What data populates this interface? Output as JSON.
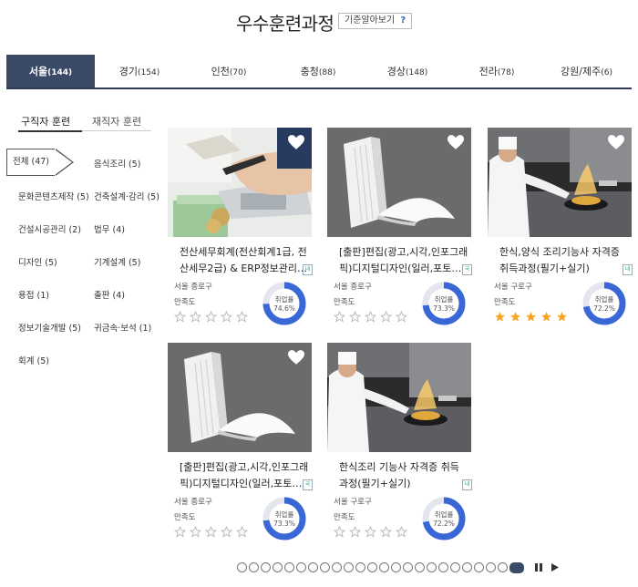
{
  "header": {
    "title": "우수훈련과정",
    "criteria_label": "기준알아보기",
    "criteria_icon": "?"
  },
  "regions": [
    {
      "label": "서울",
      "count": "(144)",
      "active": true
    },
    {
      "label": "경기",
      "count": "(154)"
    },
    {
      "label": "인천",
      "count": "(70)"
    },
    {
      "label": "충청",
      "count": "(88)"
    },
    {
      "label": "경상",
      "count": "(148)"
    },
    {
      "label": "전라",
      "count": "(78)"
    },
    {
      "label": "강원/제주",
      "count": "(6)"
    }
  ],
  "subtabs": [
    {
      "label": "구직자 훈련",
      "active": true
    },
    {
      "label": "재직자 훈련"
    }
  ],
  "categories": {
    "left": [
      "전체 (47)",
      "문화콘텐츠제작 (5)",
      "건설시공관리 (2)",
      "디자인 (5)",
      "용접 (1)",
      "정보기술개발 (5)",
      "회계 (5)"
    ],
    "right": [
      "음식조리 (5)",
      "건축설계·감리 (5)",
      "법무 (4)",
      "기계설계 (5)",
      "출판 (4)",
      "귀금속·보석 (1)"
    ]
  },
  "cards": [
    {
      "title": "전산세무회계(전산회계1급, 전산세무2급) & ERP정보관리…",
      "badge": "내",
      "location": "서울 종로구",
      "satisfaction_label": "만족도",
      "rating": 0,
      "employment_label": "취업률",
      "employment_rate": "74.6%",
      "employment_value": 74.6,
      "image": "calculator-photo"
    },
    {
      "title": "[출판]편집(광고,시각,인포그래픽)디지털디자인(일러,포토…",
      "badge": "국",
      "location": "서울 종로구",
      "satisfaction_label": "만족도",
      "rating": 0,
      "employment_label": "취업률",
      "employment_rate": "73.3%",
      "employment_value": 73.3,
      "image": "book-photo"
    },
    {
      "title": "한식,양식 조리기능사 자격증 취득과정(필기+실기)",
      "badge": "내",
      "location": "서울 구로구",
      "satisfaction_label": "만족도",
      "rating": 5,
      "employment_label": "취업률",
      "employment_rate": "72.2%",
      "employment_value": 72.2,
      "image": "chef-photo"
    },
    {
      "title": "[출판]편집(광고,시각,인포그래픽)디지털디자인(일러,포토…",
      "badge": "국",
      "location": "서울 종로구",
      "satisfaction_label": "만족도",
      "rating": 0,
      "employment_label": "취업률",
      "employment_rate": "73.3%",
      "employment_value": 73.3,
      "image": "book-photo"
    },
    {
      "title": "한식조리 기능사 자격증 취득과정(필기+실기)",
      "badge": "내",
      "location": "서울 구로구",
      "satisfaction_label": "만족도",
      "rating": 0,
      "employment_label": "취업률",
      "employment_rate": "72.2%",
      "employment_value": 72.2,
      "image": "chef-photo"
    }
  ],
  "pager": {
    "dots": 24,
    "active_index": 23
  },
  "colors": {
    "accent": "#3b4a66",
    "donut": "#3a67d6",
    "donut_track": "#e3e6ee",
    "star_on": "#f5a623",
    "star_off": "#bbbbbb"
  }
}
